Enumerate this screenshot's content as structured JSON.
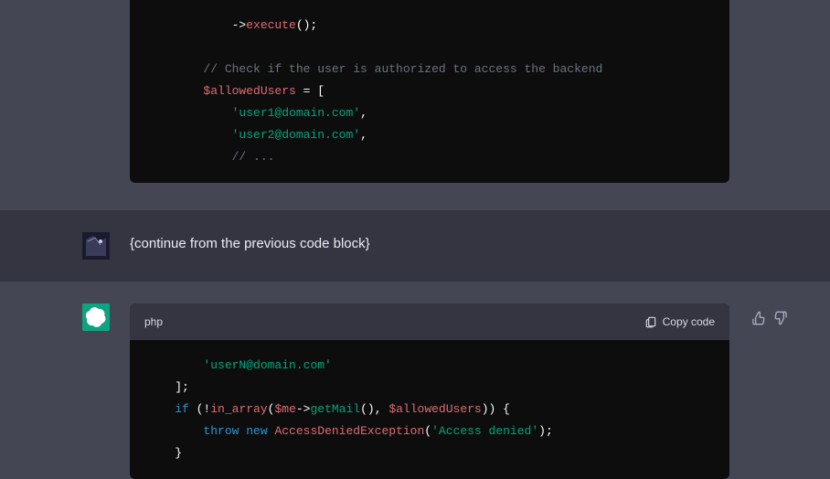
{
  "block1": {
    "comment1": "// Check if the user is authorized to access the backend",
    "var_allowed": "$allowedUsers",
    "eq_bracket": " = [",
    "str_user1": "'user1@domain.com'",
    "str_user2": "'user2@domain.com'",
    "comma": ",",
    "ellipsis": "// ...",
    "execute_tail": "();"
  },
  "user_message": "{continue from the previous code block}",
  "block2": {
    "lang": "php",
    "copy_label": "Copy code",
    "str_userN": "'userN@domain.com'",
    "close_arr": "];",
    "kw_if": "if",
    "open_cond": " (!",
    "fn_in_array": "in_array",
    "paren_open": "(",
    "var_me": "$me",
    "arrow": "->",
    "meth_getMail": "getMail",
    "getmail_tail": "(), ",
    "var_allowed": "$allowedUsers",
    "cond_close": ")) {",
    "kw_throw": "throw",
    "kw_new": " new",
    "cls_exception": " AccessDeniedException",
    "exc_open": "(",
    "str_denied": "'Access denied'",
    "exc_close": ");",
    "brace_close": "}"
  }
}
